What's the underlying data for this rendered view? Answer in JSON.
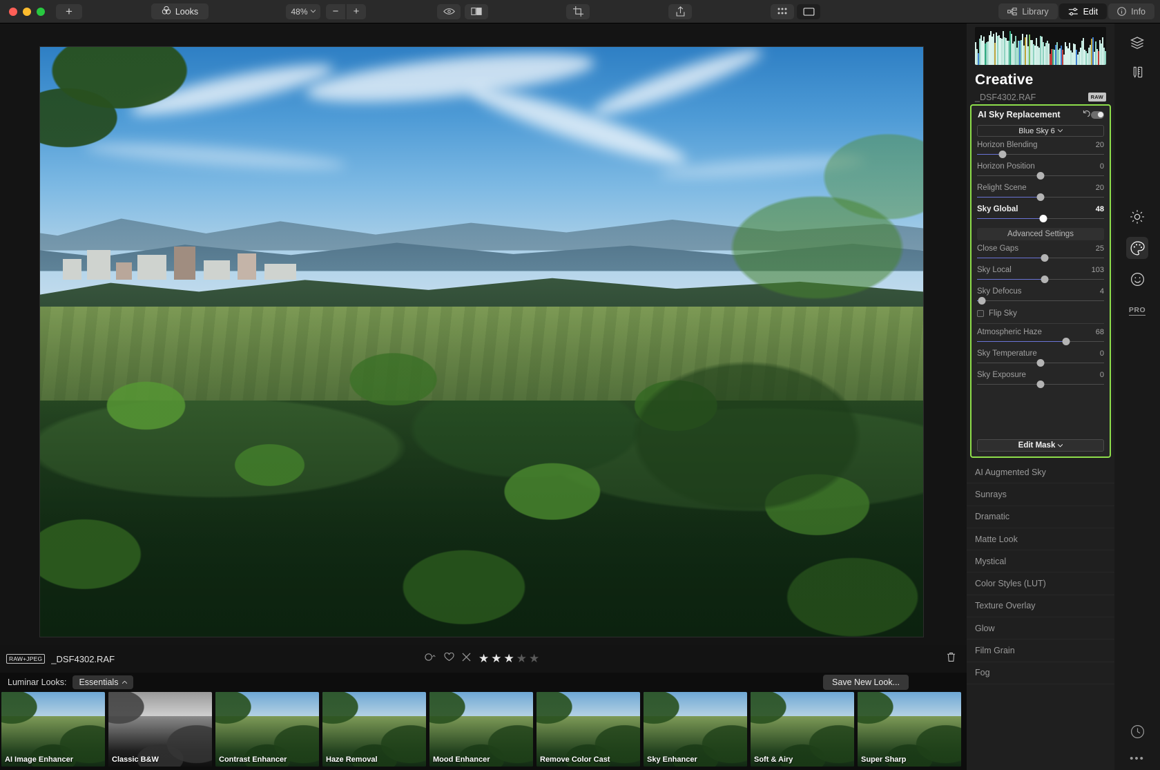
{
  "toolbar": {
    "add_label": "+",
    "looks_label": "Looks",
    "looks_icon": "venn-circles-icon",
    "zoom_level": "48%",
    "zoom_out_label": "−",
    "zoom_in_label": "+",
    "icons": [
      "eye-icon",
      "compare-split-icon",
      "crop-icon",
      "share-icon",
      "grid-view-icon",
      "single-view-icon"
    ],
    "tabs": [
      {
        "label": "Library",
        "icon": "library-icon",
        "active": false
      },
      {
        "label": "Edit",
        "icon": "sliders-icon",
        "active": true
      },
      {
        "label": "Info",
        "icon": "info-circle-icon",
        "active": false
      }
    ]
  },
  "info_strip": {
    "raw_badge": "RAW+JPEG",
    "filename": "_DSF4302.RAF",
    "reject_icon": "x-reject-icon",
    "favorite_icon": "heart-icon",
    "color_label_icon": "color-label-icon",
    "stars_filled": 3,
    "stars_total": 5,
    "trash_icon": "trash-icon"
  },
  "looks_bar": {
    "label": "Luminar Looks:",
    "collection": "Essentials",
    "save_new_label": "Save New Look...",
    "items": [
      {
        "name": "AI Image Enhancer",
        "style": "color"
      },
      {
        "name": "Classic B&W",
        "style": "bw"
      },
      {
        "name": "Contrast Enhancer",
        "style": "color"
      },
      {
        "name": "Haze Removal",
        "style": "color"
      },
      {
        "name": "Mood Enhancer",
        "style": "color"
      },
      {
        "name": "Remove Color Cast",
        "style": "color"
      },
      {
        "name": "Sky Enhancer",
        "style": "color"
      },
      {
        "name": "Soft & Airy",
        "style": "color"
      },
      {
        "name": "Super Sharp",
        "style": "color"
      }
    ]
  },
  "panel": {
    "title": "Creative",
    "filename": "_DSF4302.RAF",
    "raw_tag": "RAW",
    "card": {
      "title": "AI Sky Replacement",
      "reset_icon": "reset-arrow-icon",
      "toggle_on": true,
      "preset": "Blue Sky 6",
      "advanced_label": "Advanced Settings",
      "checkbox_label": "Flip Sky",
      "checkbox_checked": false,
      "edit_mask_label": "Edit Mask",
      "sliders_top": [
        {
          "name": "Horizon Blending",
          "value": "20",
          "pct": 20,
          "bold": false
        },
        {
          "name": "Horizon Position",
          "value": "0",
          "pct": 50,
          "bold": false
        },
        {
          "name": "Relight Scene",
          "value": "20",
          "pct": 50,
          "bold": false
        },
        {
          "name": "Sky Global",
          "value": "48",
          "pct": 52,
          "bold": true
        }
      ],
      "sliders_mid": [
        {
          "name": "Close Gaps",
          "value": "25",
          "pct": 53,
          "bold": false
        },
        {
          "name": "Sky Local",
          "value": "103",
          "pct": 53,
          "bold": false
        },
        {
          "name": "Sky Defocus",
          "value": "4",
          "pct": 4,
          "bold": false
        }
      ],
      "sliders_bottom": [
        {
          "name": "Atmospheric Haze",
          "value": "68",
          "pct": 70,
          "bold": false
        },
        {
          "name": "Sky Temperature",
          "value": "0",
          "pct": 50,
          "bold": false
        },
        {
          "name": "Sky Exposure",
          "value": "0",
          "pct": 50,
          "bold": false
        }
      ]
    },
    "filters": [
      "AI Augmented Sky",
      "Sunrays",
      "Dramatic",
      "Matte Look",
      "Mystical",
      "Color Styles (LUT)",
      "Texture Overlay",
      "Glow",
      "Film Grain",
      "Fog"
    ]
  },
  "rail": {
    "top_icons": [
      "layers-icon",
      "tools-icon"
    ],
    "mid_icons": [
      "essentials-sun-icon",
      "creative-palette-icon",
      "portrait-face-icon"
    ],
    "pro_label": "PRO",
    "history_icon": "history-clock-icon",
    "more_icon": "more-dots-icon"
  },
  "accent": {
    "highlight": "#8ede4b",
    "slider_fill": "#6a74d6"
  }
}
